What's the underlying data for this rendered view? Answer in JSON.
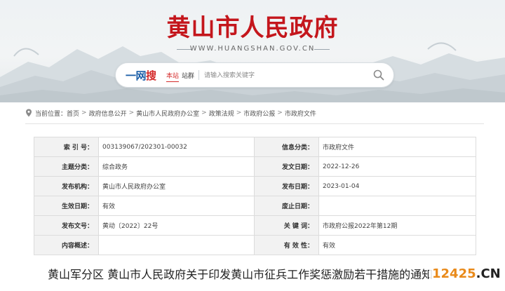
{
  "header": {
    "site_title": "黄山市人民政府",
    "site_url": "WWW.HUANGSHAN.GOV.CN"
  },
  "search": {
    "logo_main": "一网",
    "logo_accent": "搜",
    "scope_local": "本站",
    "scope_all": "站群",
    "placeholder": "请输入搜索关键字"
  },
  "breadcrumb": {
    "label": "当前位置：",
    "items": [
      "首页",
      "政府信息公开",
      "黄山市人民政府办公室",
      "政策法规",
      "市政府公报",
      "市政府文件"
    ]
  },
  "info": {
    "rows": [
      {
        "k1": "索 引 号：",
        "v1": "003139067/202301-00032",
        "k2": "信息分类：",
        "v2": "市政府文件"
      },
      {
        "k1": "主题分类：",
        "v1": "综合政务",
        "k2": "发文日期：",
        "v2": "2022-12-26"
      },
      {
        "k1": "发布机构：",
        "v1": "黄山市人民政府办公室",
        "k2": "发布日期：",
        "v2": "2023-01-04"
      },
      {
        "k1": "生效日期：",
        "v1": "有效",
        "k2": "废止日期：",
        "v2": ""
      },
      {
        "k1": "发布文号：",
        "v1": "黄动〔2022〕22号",
        "k2": "关 键 词：",
        "v2": "市政府公报2022年第12期"
      },
      {
        "k1": "内容概述：",
        "v1": "",
        "k2": "有 效 性：",
        "v2": "有效"
      }
    ]
  },
  "article": {
    "title": "黄山军分区  黄山市人民政府关于印发黄山市征兵工作奖惩激励若干措施的通知"
  },
  "watermark": {
    "number": "12425",
    "domain": ".CN"
  },
  "colors": {
    "title_red": "#c4161c",
    "logo_blue": "#1c5fa8",
    "accent_red": "#d42a2a",
    "watermark_orange": "#e98a1a"
  }
}
